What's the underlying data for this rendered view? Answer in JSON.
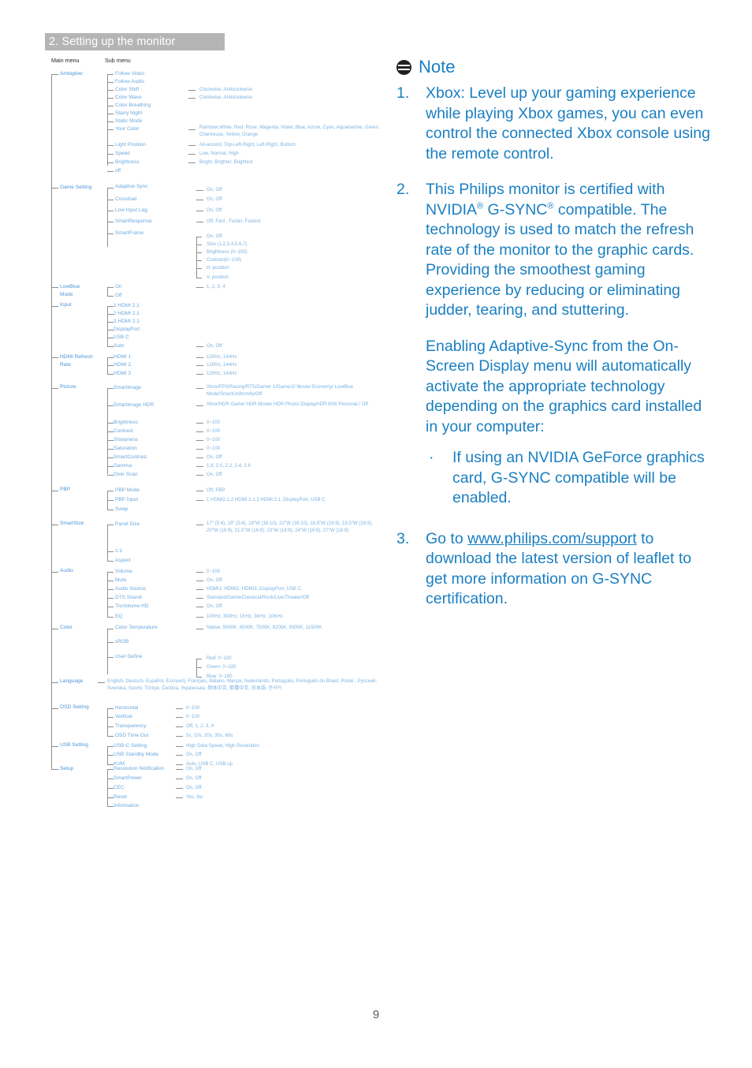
{
  "header": {
    "chapter_title": "2. Setting up the monitor"
  },
  "footer": {
    "page_number": "9"
  },
  "menu_tree": {
    "columns": {
      "main": "Main menu",
      "sub": "Sub menu"
    },
    "items": [
      {
        "main": "Ambiglow",
        "subs": [
          {
            "label": "Follow Video",
            "options": ""
          },
          {
            "label": "Follow Audio",
            "options": ""
          },
          {
            "label": "Color Shift",
            "options": "Clockwise, Anticlockwise"
          },
          {
            "label": "Color Wave",
            "options": "Clockwise, Anticlockwise"
          },
          {
            "label": "Color Breathing",
            "options": ""
          },
          {
            "label": "Starry Night",
            "options": ""
          },
          {
            "label": "Static Mode",
            "options": ""
          },
          {
            "label": "Your Color",
            "options": "Rainbow,White, Red, Rose, Magenta, Violet, Blue, Azure, Cyan, Aquamarine, Green, Chartreuse, Yellow, Orange"
          },
          {
            "label": "Light Position",
            "options": "All-around, Top-Left-Right, Left-Right, Bottom"
          },
          {
            "label": "Speed",
            "options": "Low, Normal, High"
          },
          {
            "label": "Brightness",
            "options": "Bright, Brighter, Brightest"
          },
          {
            "label": "off",
            "options": ""
          }
        ]
      },
      {
        "main": "Game Setting",
        "subs": [
          {
            "label": "Adaptive Sync",
            "options": "On, Off"
          },
          {
            "label": "Crosshair",
            "options": "On, Off"
          },
          {
            "label": "Low Input Lag",
            "options": "On, Off"
          },
          {
            "label": "SmartResponse",
            "options": "Off, Fast , Faster, Fastest"
          },
          {
            "label": "SmartFrame",
            "options": ""
          }
        ]
      },
      {
        "main": "LowBlue Mode",
        "subs": [
          {
            "label": "On",
            "options": "1, 2, 3, 4"
          },
          {
            "label": "Off",
            "options": ""
          }
        ]
      },
      {
        "main": "Input",
        "subs": [
          {
            "label": "1 HDMI 2.1",
            "options": ""
          },
          {
            "label": "2 HDMI 2.1",
            "options": ""
          },
          {
            "label": "3 HDMI 2.1",
            "options": ""
          },
          {
            "label": "DisplayPort",
            "options": ""
          },
          {
            "label": "USB C",
            "options": ""
          },
          {
            "label": "Auto",
            "options": "On, Off"
          }
        ]
      },
      {
        "main": "HDMI Refresh Rate",
        "subs": [
          {
            "label": "HDMI 1",
            "options": "120Hz, 144Hz"
          },
          {
            "label": "HDMI 2",
            "options": "120Hz, 144Hz"
          },
          {
            "label": "HDMI 3",
            "options": "120Hz, 144Hz"
          }
        ]
      },
      {
        "main": "Picture",
        "subs": [
          {
            "label": "SmartImage",
            "options": "Xbox/FPS/Racing/RTS/Gamer 1/Gamer2/ Movie/ Economy/ LowBlue Mode/SmartUniformity/Off"
          },
          {
            "label": "SmartImage HDR",
            "options": "Xbox/HDR Game/ HDR Movie/ HDR Photo/ DisplayHDR 600/ Personal / Off"
          },
          {
            "label": "Brightness",
            "options": "0~100"
          },
          {
            "label": "Contrast",
            "options": "0~100"
          },
          {
            "label": "Sharpness",
            "options": "0~100"
          },
          {
            "label": "Saturation",
            "options": "0~100"
          },
          {
            "label": "SmartContrast",
            "options": "On, Off"
          },
          {
            "label": "Gamma",
            "options": "1.8, 2.0, 2.2, 2.4, 2.6"
          },
          {
            "label": "Over Scan",
            "options": "On, Off"
          }
        ]
      },
      {
        "main": "PBP",
        "subs": [
          {
            "label": "PBP Mode",
            "options": "Off, PBP"
          },
          {
            "label": "PBP Input",
            "options": "1 HDMI2.1,2 HDMI 2.1,3 HDMI 2.1 ,DisplayPort, USB C"
          },
          {
            "label": "Swap",
            "options": ""
          }
        ]
      },
      {
        "main": "SmartSize",
        "subs": [
          {
            "label": "Panel Size",
            "options": "17\" (5:4), 19\" (5:4), 19\"W (16:10), 22\"W (16:10), 18.5\"W (16:9), 19.5\"W (16:9), 20\"W (16:9),  21.5\"W (16:9),  23\"W (16:9),  24\"W (16:9),  27\"W (16:9)"
          },
          {
            "label": "1:1",
            "options": ""
          },
          {
            "label": "Aspect",
            "options": ""
          }
        ]
      },
      {
        "main": "Audio",
        "subs": [
          {
            "label": "Volume",
            "options": "0~100"
          },
          {
            "label": "Mute",
            "options": "On, Off"
          },
          {
            "label": "Audio Source",
            "options": "HDMI1, HDMI2, HDMI3, DisplayPort, USB C"
          },
          {
            "label": "DTS Sound",
            "options": "Standard/Game/Classical/Rock/Live/Theater/Off"
          },
          {
            "label": "TruVolume HD",
            "options": "On, Off"
          },
          {
            "label": "EQ",
            "options": "100Hz, 300Hz, 1KHz, 3KHz, 10KHz"
          }
        ]
      },
      {
        "main": "Color",
        "subs": [
          {
            "label": "Color Temperature",
            "options": "Native, 5000K, 6500K, 7500K, 8200K, 9300K, 11500K"
          },
          {
            "label": "sRGB",
            "options": ""
          },
          {
            "label": "User Define",
            "options": ""
          }
        ]
      },
      {
        "main": "Language",
        "subs": [
          {
            "label": "English, Deutsch, Español, Ελληνική, Français, Italiano, Maryar, Nederlands, Português, Português do Brasil, Polski , Русский, Svenska, Suomi, Türkçe, Čeština, Українська, 简体中文, 繁體中文, 日本語, 한국어",
            "options": ""
          }
        ]
      },
      {
        "main": "OSD Setting",
        "subs": [
          {
            "label": "Horizontal",
            "options": "0~100"
          },
          {
            "label": "Vertical",
            "options": "0~100"
          },
          {
            "label": "Transparency",
            "options": "Off, 1, 2, 3, 4"
          },
          {
            "label": "OSD Time Out",
            "options": "5s, 10s, 20s, 30s, 60s"
          }
        ]
      },
      {
        "main": "USB Setting",
        "subs": [
          {
            "label": "USB-C Setting",
            "options": "High Data Speed, High Resolution"
          },
          {
            "label": "USB Standby Mode",
            "options": "On, Off"
          },
          {
            "label": "KVM",
            "options": "Auto, USB C, USB up"
          }
        ]
      },
      {
        "main": "Setup",
        "subs": [
          {
            "label": "Resolution Notification",
            "options": "On, Off"
          },
          {
            "label": "SmartPower",
            "options": "On, Off"
          },
          {
            "label": "CEC",
            "options": "On, Off"
          },
          {
            "label": "Reset",
            "options": "Yes, No"
          },
          {
            "label": "Information",
            "options": ""
          }
        ]
      }
    ],
    "smartframe_options": [
      "On, Off",
      "Size (1,2,3,4,5,6,7)",
      "Brightness (0~100)",
      "Contrast(0~100)",
      "H. position",
      "V. position"
    ],
    "user_define_options": [
      "Red: 0~100",
      "Green: 0~100",
      "Blue: 0~100"
    ]
  },
  "note": {
    "icon": "note-icon",
    "title": "Note",
    "items": [
      {
        "number": "1.",
        "text": "Xbox: Level up your gaming experience while playing Xbox games, you can even control the connected Xbox console using the remote control."
      },
      {
        "number": "2.",
        "text_a": "This Philips monitor is certified with NVIDIA",
        "reg1": "®",
        "text_b": " G-SYNC",
        "reg2": "®",
        "text_c": " compatible. The technology is used to match the refresh rate of the monitor to the graphic cards. Providing the smoothest gaming experience by reducing or eliminating judder, tearing, and stuttering.",
        "paragraph2": "Enabling Adaptive-Sync from the On-Screen Display menu will automatically activate the appropriate technology depending on the graphics card installed in your computer:",
        "bullet_glyph": "·",
        "bullet_text": "If using an NVIDIA GeForce graphics card, G-SYNC compatible will be enabled."
      },
      {
        "number": "3.",
        "text_pre": "Go to ",
        "link": "www.philips.com/support",
        "text_post": " to download the latest version of leaflet to get more information on G-SYNC certification."
      }
    ]
  }
}
